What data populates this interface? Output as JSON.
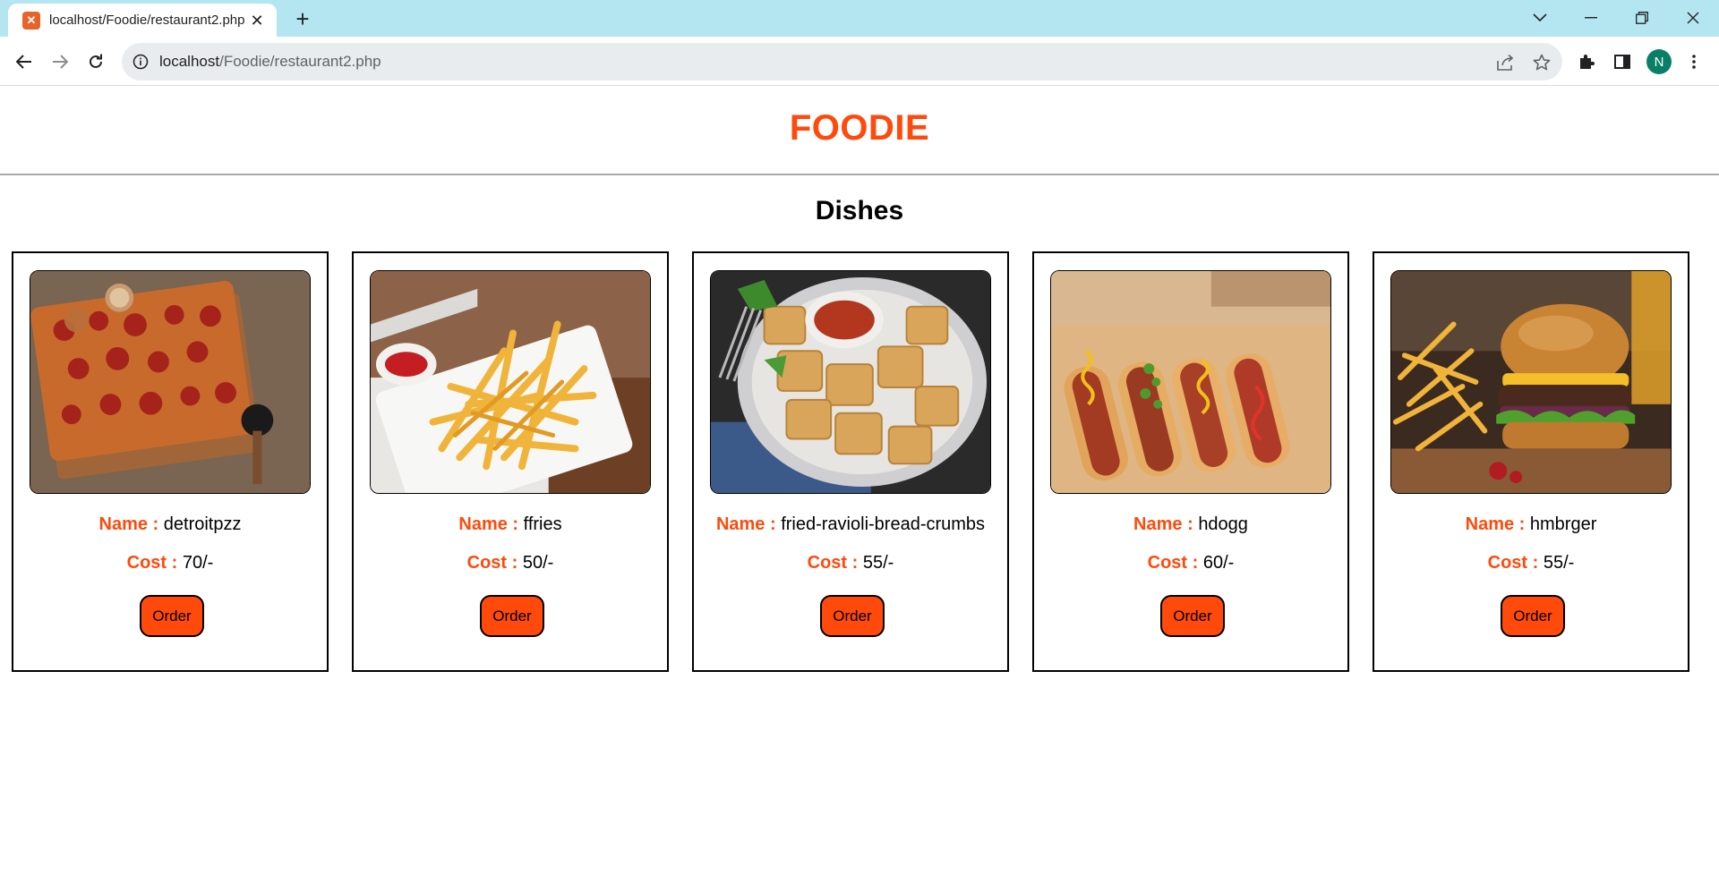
{
  "browser": {
    "tab": {
      "title": "localhost/Foodie/restaurant2.php"
    },
    "address": {
      "host": "localhost",
      "path": "/Foodie/restaurant2.php"
    },
    "profile_initial": "N"
  },
  "page": {
    "brand": "FOODIE",
    "section_title": "Dishes",
    "name_label": "Name :",
    "cost_label": "Cost :",
    "order_label": "Order",
    "dishes": [
      {
        "name": "detroitpzz",
        "cost": "70/-",
        "image": "pizza-image"
      },
      {
        "name": "ffries",
        "cost": "50/-",
        "image": "fries-image"
      },
      {
        "name": "fried-ravioli-bread-crumbs",
        "cost": "55/-",
        "image": "ravioli-image"
      },
      {
        "name": "hdogg",
        "cost": "60/-",
        "image": "hotdog-image"
      },
      {
        "name": "hmbrger",
        "cost": "55/-",
        "image": "burger-image"
      }
    ]
  },
  "colors": {
    "accent": "#ff4a0c",
    "tabstrip": "#b4e6f2",
    "avatar": "#0a7f68"
  }
}
